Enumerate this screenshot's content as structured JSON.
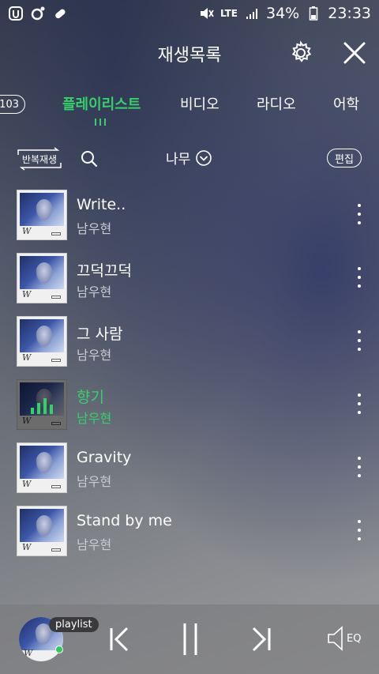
{
  "status_bar": {
    "battery": "34%",
    "time": "23:33",
    "network": "LTE"
  },
  "header": {
    "title": "재생목록"
  },
  "tabs": {
    "count": "103",
    "items": [
      {
        "label": "플레이리스트",
        "active": true
      },
      {
        "label": "비디오",
        "active": false
      },
      {
        "label": "라디오",
        "active": false
      },
      {
        "label": "어학",
        "active": false
      }
    ]
  },
  "toolbar": {
    "repeat_label": "반복재생",
    "sort_label": "나무",
    "edit_label": "편집"
  },
  "songs": [
    {
      "title": "Write..",
      "artist": "남우현",
      "playing": false
    },
    {
      "title": "끄덕끄덕",
      "artist": "남우현",
      "playing": false
    },
    {
      "title": "그 사람",
      "artist": "남우현",
      "playing": false
    },
    {
      "title": "향기",
      "artist": "남우현",
      "playing": true
    },
    {
      "title": "Gravity",
      "artist": "남우현",
      "playing": false
    },
    {
      "title": "Stand by me",
      "artist": "남우현",
      "playing": false
    }
  ],
  "album_mark": "W",
  "player": {
    "badge": "playlist",
    "eq_label": "EQ"
  },
  "colors": {
    "accent": "#35d06a"
  }
}
